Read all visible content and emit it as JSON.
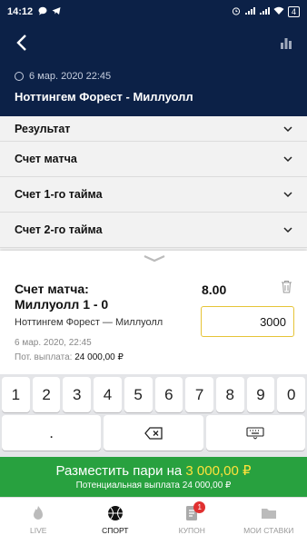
{
  "status": {
    "time": "14:12",
    "battery": "4"
  },
  "header": {
    "date": "6 мар. 2020 22:45",
    "title": "Ноттингем Форест - Миллуолл"
  },
  "markets": [
    {
      "label": "Результат"
    },
    {
      "label": "Счет матча"
    },
    {
      "label": "Счет 1-го тайма"
    },
    {
      "label": "Счет 2-го тайма"
    }
  ],
  "slip": {
    "title_line1": "Счет матча:",
    "title_line2": "Миллуолл 1 - 0",
    "odds": "8.00",
    "event": "Ноттингем Форест — Миллуолл",
    "stake": "3000",
    "date": "6 мар. 2020, 22:45",
    "payout_label": "Пот. выплата:",
    "payout_value": "24 000,00 ₽"
  },
  "keyboard": {
    "row1": [
      "1",
      "2",
      "3",
      "4",
      "5",
      "6",
      "7",
      "8",
      "9",
      "0"
    ],
    "dot": "."
  },
  "place_bet": {
    "label": "Разместить пари на",
    "amount": "3 000,00 ₽",
    "sub": "Потенциальная выплата 24 000,00 ₽"
  },
  "nav": [
    {
      "label": "LIVE",
      "icon": "fire-icon"
    },
    {
      "label": "СПОРТ",
      "icon": "ball-icon"
    },
    {
      "label": "КУПОН",
      "icon": "coupon-icon",
      "badge": "1"
    },
    {
      "label": "МОИ СТАВКИ",
      "icon": "folder-icon"
    }
  ],
  "colors": {
    "header": "#0c2147",
    "accent_green": "#28a13f",
    "amount_yellow": "#ffe23b",
    "input_border": "#e6c437",
    "badge_red": "#e03030"
  }
}
